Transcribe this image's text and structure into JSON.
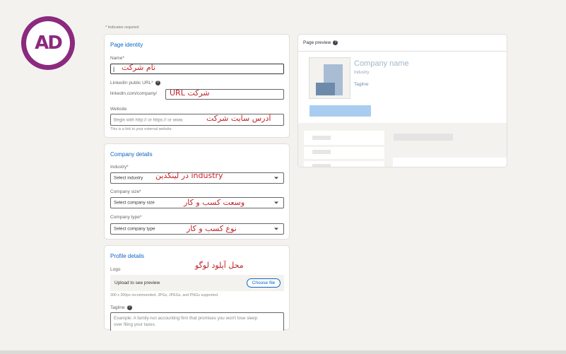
{
  "brand": {
    "logo_text": "AD",
    "color": "#8b2a7e"
  },
  "required_note": "* Indicates required",
  "page_identity": {
    "title": "Page identity",
    "name_label": "Name*",
    "name_value": "|",
    "name_annotation": "نام شرکت",
    "linkedin_url_label": "LinkedIn public URL*",
    "linkedin_url_prefix": "linkedin.com/company/",
    "linkedin_url_annotation": "شرکت URL",
    "website_label": "Website",
    "website_placeholder": "Begin with http:// or https:// or www.",
    "website_annotation": "آدرس سایت شرکت",
    "website_help": "This is a link to your external website."
  },
  "company_details": {
    "title": "Company details",
    "industry_label": "Industry*",
    "industry_value": "Select industry",
    "industry_annotation": "industry در لینکدین",
    "size_label": "Company size*",
    "size_value": "Select company size",
    "size_annotation": "وسعت کسب و کار",
    "type_label": "Company type*",
    "type_value": "Select company type",
    "type_annotation": "نوع کسب و کار"
  },
  "profile_details": {
    "title": "Profile details",
    "logo_label": "Logo",
    "logo_annotation": "محل آپلود لوگو",
    "upload_text": "Upload to see preview",
    "choose_file": "Choose file",
    "logo_help": "300 x 300px recommended. JPGs, JPEGs, and PNGs supported.",
    "tagline_label": "Tagline",
    "tagline_placeholder_1": "Example: A family-run accounting firm that promises you won't lose sleep",
    "tagline_placeholder_2": "over filing your taxes."
  },
  "preview": {
    "title": "Page preview",
    "company_name": "Company name",
    "industry": "Industry",
    "tagline": "Tagline",
    "accent": "#0a66c2"
  }
}
